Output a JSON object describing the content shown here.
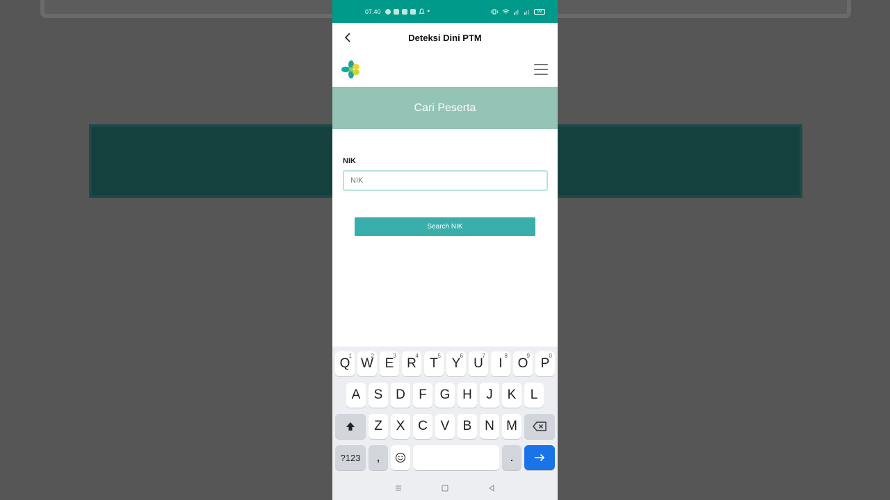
{
  "statusbar": {
    "time": "07.40",
    "battery": "99"
  },
  "appbar": {
    "title": "Deteksi Dini PTM"
  },
  "banner": {
    "title": "Cari Peserta"
  },
  "form": {
    "nik_label": "NIK",
    "nik_placeholder": "NIK",
    "nik_value": "",
    "search_button": "Search NIK"
  },
  "keyboard": {
    "row1": [
      {
        "key": "Q",
        "hint": "1"
      },
      {
        "key": "W",
        "hint": "2"
      },
      {
        "key": "E",
        "hint": "3"
      },
      {
        "key": "R",
        "hint": "4"
      },
      {
        "key": "T",
        "hint": "5"
      },
      {
        "key": "Y",
        "hint": "6"
      },
      {
        "key": "U",
        "hint": "7"
      },
      {
        "key": "I",
        "hint": "8"
      },
      {
        "key": "O",
        "hint": "9"
      },
      {
        "key": "P",
        "hint": "0"
      }
    ],
    "row2": [
      "A",
      "S",
      "D",
      "F",
      "G",
      "H",
      "J",
      "K",
      "L"
    ],
    "row3": [
      "Z",
      "X",
      "C",
      "V",
      "B",
      "N",
      "M"
    ],
    "symbols_label": "?123",
    "comma": ",",
    "period": "."
  },
  "colors": {
    "statusbar": "#009a8a",
    "banner": "#93c4b5",
    "button": "#3aaeaa",
    "enter_key": "#1a73e8"
  }
}
